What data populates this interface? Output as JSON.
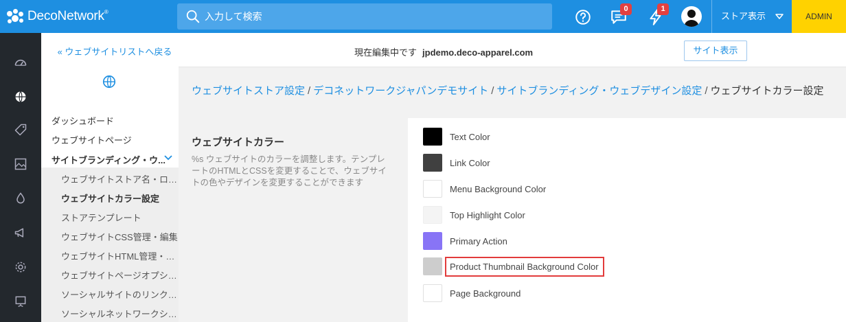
{
  "app": {
    "logo_text": "DecoNetwork",
    "logo_mark": "®"
  },
  "search": {
    "placeholder": "入力して検索"
  },
  "topbar": {
    "messages_badge": "0",
    "alerts_badge": "1",
    "store_view_label": "ストア表示",
    "admin_label": "ADMIN"
  },
  "colors": {
    "brand": "#1e8fe1",
    "rail": "#23282d",
    "admin": "#ffd200",
    "badge": "#e24040",
    "highlight": "#e23b3b"
  },
  "nav": {
    "back_link": "« ウェブサイトリストへ戻る",
    "items": [
      {
        "label": "ダッシュボード"
      },
      {
        "label": "ウェブサイトページ"
      },
      {
        "label": "サイトブランディング・ウ..."
      }
    ],
    "sub_items": [
      {
        "label": "ウェブサイトストア名・ロゴ..."
      },
      {
        "label": "ウェブサイトカラー設定"
      },
      {
        "label": "ストアテンプレート"
      },
      {
        "label": "ウェブサイトCSS管理・編集"
      },
      {
        "label": "ウェブサイトHTML管理・編集"
      },
      {
        "label": "ウェブサイトページオプショ..."
      },
      {
        "label": "ソーシャルサイトのリンク設定"
      },
      {
        "label": "ソーシャルネットワークシェ..."
      }
    ]
  },
  "edit_bar": {
    "editing_label": "現在編集中です",
    "domain": "jpdemo.deco-apparel.com",
    "view_site_button": "サイト表示"
  },
  "breadcrumb": {
    "items": [
      "ウェブサイトストア設定",
      "デコネットワークジャパンデモサイト",
      "サイトブランディング・ウェブデザイン設定",
      "ウェブサイトカラー設定"
    ],
    "separator": "/"
  },
  "section": {
    "title": "ウェブサイトカラー",
    "description": "%s ウェブサイトのカラーを調整します。テンプレートのHTMLとCSSを変更することで、ウェブサイトの色やデザインを変更することができます"
  },
  "color_settings": [
    {
      "label": "Text Color",
      "color": "#000000"
    },
    {
      "label": "Link Color",
      "color": "#404040"
    },
    {
      "label": "Menu Background Color",
      "color": "#ffffff"
    },
    {
      "label": "Top Highlight Color",
      "color": "#f4f4f4"
    },
    {
      "label": "Primary Action",
      "color": "#8874f6"
    },
    {
      "label": "Product Thumbnail Background Color",
      "color": "#cdcdcd"
    },
    {
      "label": "Page Background",
      "color": "#ffffff"
    }
  ]
}
